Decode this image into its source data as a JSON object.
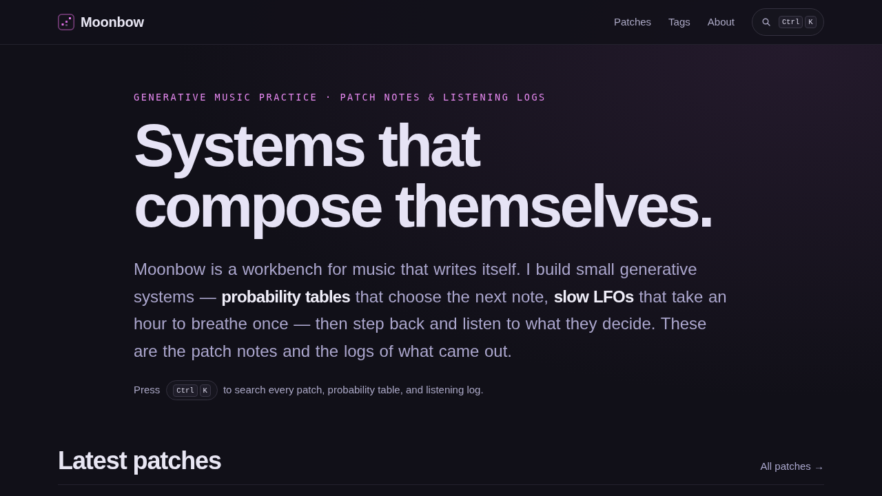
{
  "header": {
    "brand": "Moonbow",
    "nav": [
      {
        "label": "Patches"
      },
      {
        "label": "Tags"
      },
      {
        "label": "About"
      }
    ],
    "search_button": {
      "keys": [
        "Ctrl",
        "K"
      ]
    }
  },
  "hero": {
    "eyebrow": "GENERATIVE MUSIC PRACTICE · PATCH NOTES & LISTENING LOGS",
    "headline": "Systems that compose themselves.",
    "intro": "Moonbow is a workbench for music that writes itself. I build small generative systems — **probability tables** that choose the next note, **slow LFOs** that take an hour to breathe once — then step back and listen to what they decide. These are the patch notes and the logs of what came out.",
    "hint": {
      "before": "Press",
      "keys": [
        "Ctrl",
        "K"
      ],
      "after": "to search every patch, probability table, and listening log."
    }
  },
  "latest": {
    "title": "Latest patches",
    "link": "All patches →"
  }
}
